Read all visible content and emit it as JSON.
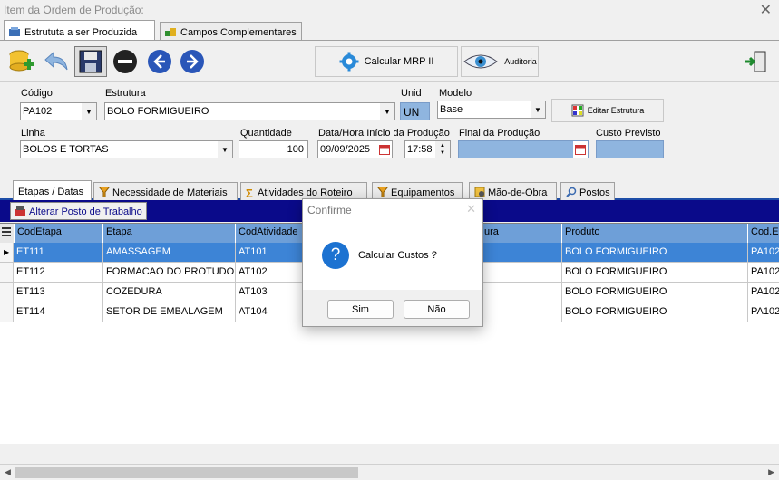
{
  "window": {
    "title": "Item da Ordem de Produção:",
    "close_icon": "close-icon"
  },
  "top_tabs": [
    {
      "label": "Estrututa a ser Produzida",
      "icon": "structure-icon",
      "active": true
    },
    {
      "label": "Campos Complementares",
      "icon": "fields-icon",
      "active": false
    }
  ],
  "toolbar": {
    "add_icon": "add-database-icon",
    "undo_icon": "undo-icon",
    "save_icon": "save-icon",
    "remove_icon": "remove-icon",
    "prev_icon": "prev-icon",
    "next_icon": "next-icon",
    "calc_label": "Calcular MRP II",
    "audit_label": "Auditoria",
    "exit_icon": "exit-icon"
  },
  "form": {
    "codigo_label": "Código",
    "codigo_value": "PA102",
    "estrutura_label": "Estrutura",
    "estrutura_value": "BOLO FORMIGUEIRO",
    "unid_label": "Unid",
    "unid_value": "UN",
    "modelo_label": "Modelo",
    "modelo_value": "Base",
    "editar_label": "Editar Estrutura",
    "linha_label": "Linha",
    "linha_value": "BOLOS E TORTAS",
    "quantidade_label": "Quantidade",
    "quantidade_value": "100",
    "data_inicio_label": "Data/Hora Início da Produção",
    "data_inicio_date": "09/09/2025",
    "data_inicio_time": "17:58",
    "final_label": "Final da Produção",
    "final_value": "",
    "custo_label": "Custo Previsto",
    "custo_value": ""
  },
  "lower_tabs": [
    {
      "label": "Etapas / Datas",
      "active": true
    },
    {
      "label": "Necessidade de Materiais",
      "active": false
    },
    {
      "label": "Atividades do Roteiro",
      "active": false
    },
    {
      "label": "Equipamentos",
      "active": false
    },
    {
      "label": "Mão-de-Obra",
      "active": false
    },
    {
      "label": "Postos",
      "active": false
    }
  ],
  "subbar": {
    "button_label": "Alterar Posto de Trabalho"
  },
  "grid": {
    "columns": [
      "CodEtapa",
      "Etapa",
      "CodAtividade",
      "ura",
      "Produto",
      "Cod.E"
    ],
    "rows": [
      [
        "ET111",
        "AMASSAGEM",
        "AT101",
        "",
        "BOLO FORMIGUEIRO",
        "PA102"
      ],
      [
        "ET112",
        "FORMACAO DO PROTUDO",
        "AT102",
        "",
        "BOLO FORMIGUEIRO",
        "PA102"
      ],
      [
        "ET113",
        "COZEDURA",
        "AT103",
        "",
        "BOLO FORMIGUEIRO",
        "PA102"
      ],
      [
        "ET114",
        "SETOR DE EMBALAGEM",
        "AT104",
        "",
        "BOLO FORMIGUEIRO",
        "PA102"
      ]
    ],
    "selected_row": 0
  },
  "dialog": {
    "title": "Confirme",
    "message": "Calcular Custos ?",
    "yes_label": "Sim",
    "no_label": "Não",
    "icon": "question-icon"
  },
  "colors": {
    "header_blue": "#6e9fd8",
    "selection_blue": "#3d84d6",
    "navy": "#0a0a8a"
  }
}
